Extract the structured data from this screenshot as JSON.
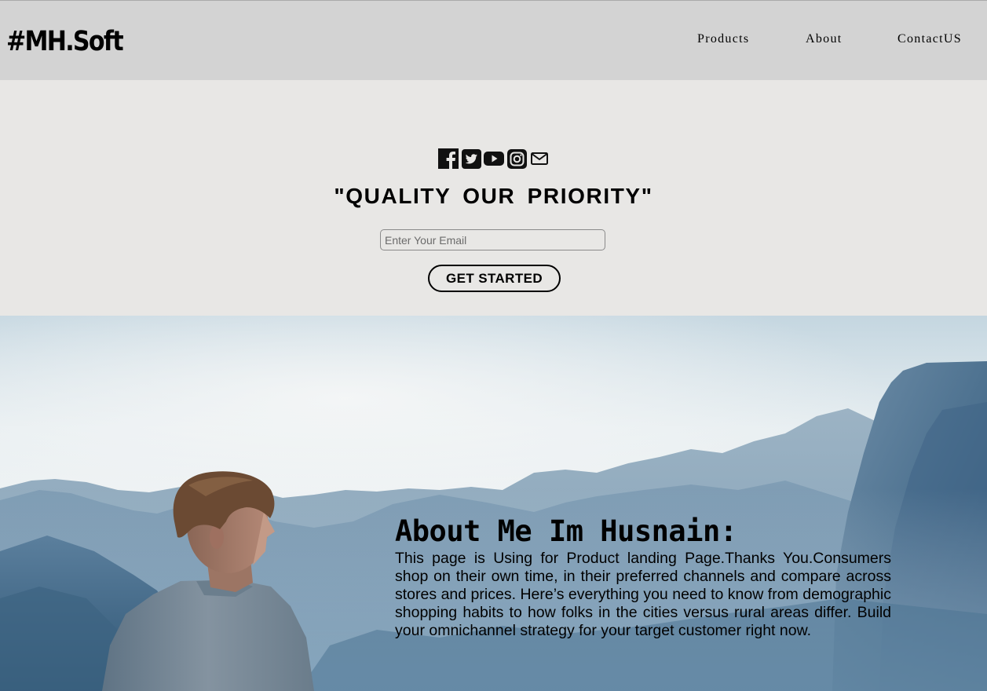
{
  "header": {
    "logo": "#MH.Soft",
    "nav": [
      "Products",
      "About",
      "ContactUS"
    ]
  },
  "hero": {
    "social_icons": [
      "facebook-icon",
      "twitter-icon",
      "youtube-icon",
      "instagram-icon",
      "mail-icon"
    ],
    "tagline": "\"QUALITY OUR PRIORITY\"",
    "email_placeholder": "Enter Your Email",
    "email_value": "",
    "cta_label": "GET STARTED"
  },
  "about": {
    "title": "About Me Im Husnain:",
    "text": "This page is Using for Product landing Page.Thanks You.Consumers shop on their own time, in their preferred channels and compare across stores and prices. Here’s everything you need to know from demographic shopping habits to how folks in the cities versus rural areas differ. Build your omnichannel strategy for your target customer right now."
  },
  "colors": {
    "header_bg": "#d3d3d3",
    "hero_bg": "#e8e7e5",
    "text": "#000000"
  }
}
